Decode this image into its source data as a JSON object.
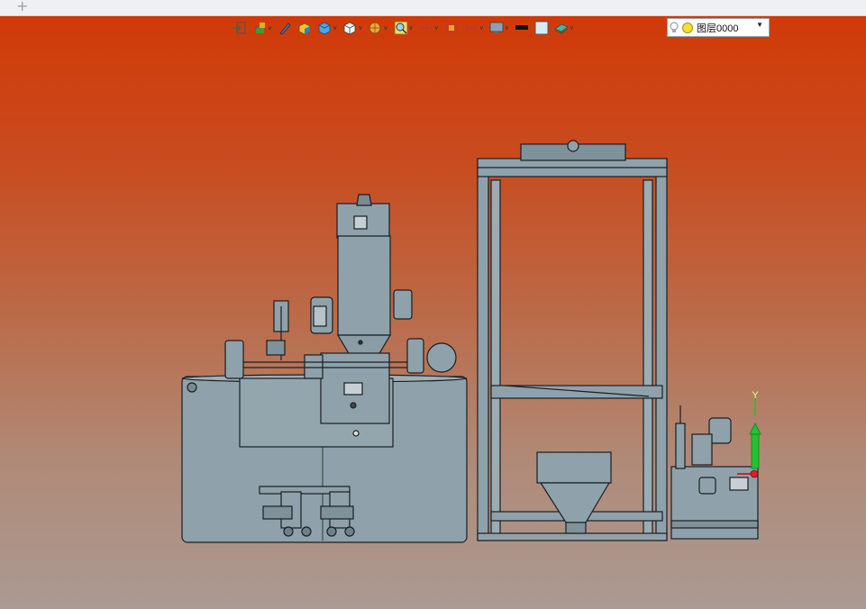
{
  "tabbar": {
    "new_tab_label": "+"
  },
  "toolbar": {
    "tools": [
      {
        "name": "exit-icon",
        "dropdown": false
      },
      {
        "name": "tree-icon",
        "dropdown": true
      },
      {
        "name": "pen-icon",
        "dropdown": false
      },
      {
        "name": "shaded-box-icon",
        "dropdown": false
      },
      {
        "name": "blue-cube-icon",
        "dropdown": true
      },
      {
        "name": "white-cube-icon",
        "dropdown": true
      },
      {
        "name": "sphere-icon",
        "dropdown": true
      },
      {
        "name": "zoom-icon",
        "dropdown": true
      },
      {
        "name": "move-icon",
        "dropdown": true
      },
      {
        "name": "fit-icon",
        "dropdown": false
      },
      {
        "name": "section-icon",
        "dropdown": true
      },
      {
        "name": "display-icon",
        "dropdown": true
      },
      {
        "name": "line-color-icon",
        "dropdown": false
      },
      {
        "name": "face-color-icon",
        "dropdown": false
      },
      {
        "name": "layer-style-icon",
        "dropdown": true
      }
    ],
    "layer_select": {
      "value": "图层0000",
      "dropdown_arrow": "▼"
    }
  },
  "axis": {
    "y_label": "Y"
  },
  "colors": {
    "model_fill": "#8fa2ab",
    "model_line": "#1a1e22",
    "axis_y": "#22c232",
    "axis_x": "#d62222"
  }
}
